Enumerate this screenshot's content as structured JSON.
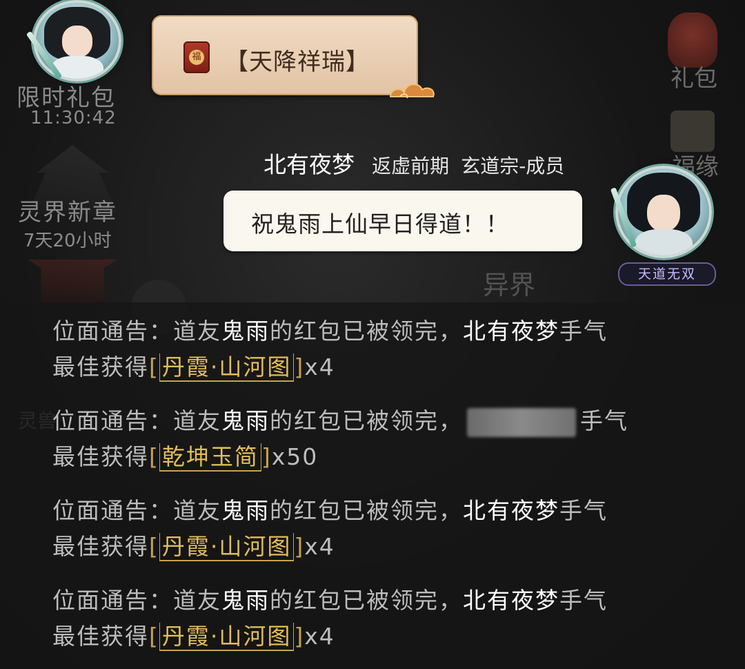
{
  "announcement": {
    "icon_text": "福",
    "title": "【天降祥瑞】"
  },
  "left_panel": {
    "gift_title": "限时礼包",
    "gift_timer": "11:30:42",
    "new_chapter": "灵界新章",
    "chapter_countdown": "7天20小时",
    "faint_label": "灵兽"
  },
  "right_panel": {
    "gift_label": "礼包",
    "fortune_label": "福缘",
    "yijie_label": "异界"
  },
  "sender": {
    "name": "北有夜梦",
    "rank": "返虚前期",
    "sect": "玄道宗-成员",
    "message": "祝鬼雨上仙早日得道！！",
    "title_badge": "天道无双"
  },
  "log": [
    {
      "prefix": "位面通告：道友",
      "giver": "鬼雨",
      "middle": "的红包已被领完，",
      "winner": "北有夜梦",
      "suffix": "手气",
      "line2": "最佳获得",
      "item": "丹霞·山河图",
      "qty": "x4"
    },
    {
      "prefix": "位面通告：道友",
      "giver": "鬼雨",
      "middle": "的红包已被领完，",
      "winner": "",
      "suffix": "手气",
      "line2": "最佳获得",
      "item": "乾坤玉简",
      "qty": "x50"
    },
    {
      "prefix": "位面通告：道友",
      "giver": "鬼雨",
      "middle": "的红包已被领完，",
      "winner": "北有夜梦",
      "suffix": "手气",
      "line2": "最佳获得",
      "item": "丹霞·山河图",
      "qty": "x4"
    },
    {
      "prefix": "位面通告：道友",
      "giver": "鬼雨",
      "middle": "的红包已被领完，",
      "winner": "北有夜梦",
      "suffix": "手气",
      "line2": "最佳获得",
      "item": "丹霞·山河图",
      "qty": "x4"
    }
  ]
}
